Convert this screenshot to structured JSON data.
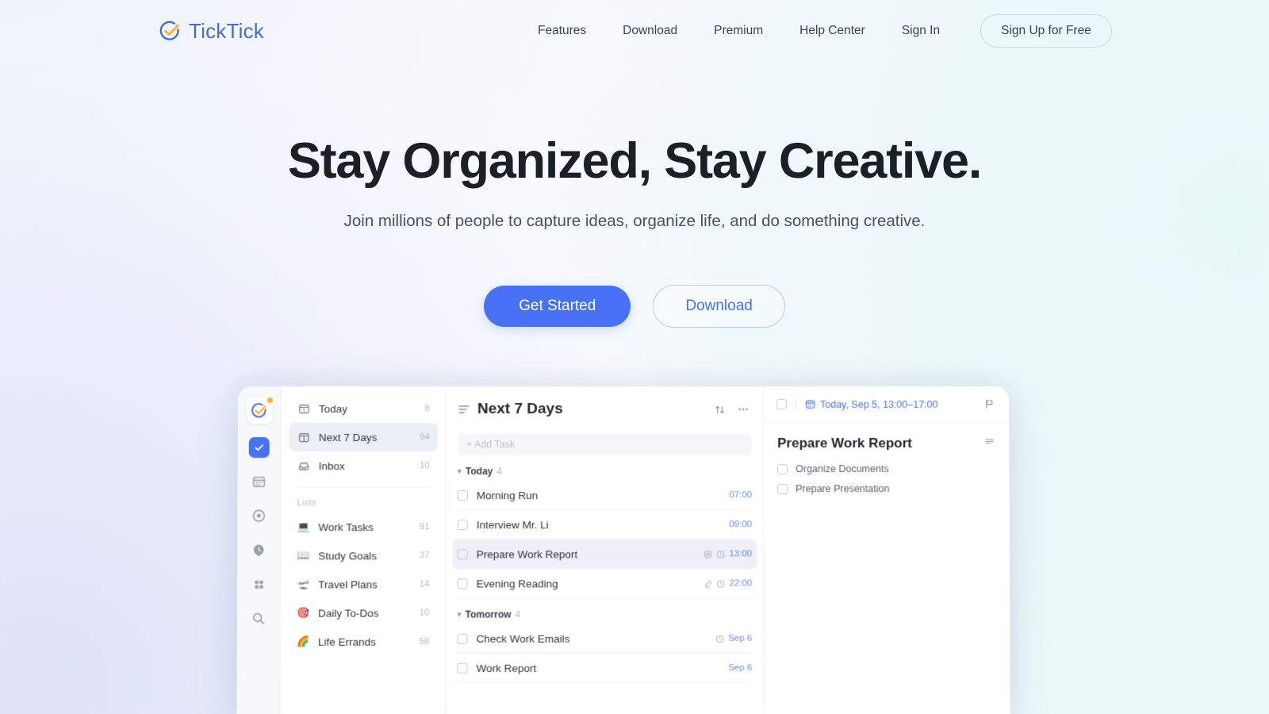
{
  "brand": {
    "name": "TickTick",
    "logo_icon": "ticktick-check-circle-icon",
    "logo_color": "#4a6bd6",
    "accent_color": "#ffb224"
  },
  "nav": {
    "links": [
      {
        "label": "Features"
      },
      {
        "label": "Download"
      },
      {
        "label": "Premium"
      },
      {
        "label": "Help Center"
      },
      {
        "label": "Sign In"
      }
    ],
    "signup_label": "Sign Up for Free"
  },
  "hero": {
    "title": "Stay Organized, Stay Creative.",
    "subtitle": "Join millions of people to capture ideas, organize life, and do something creative.",
    "primary_cta": "Get Started",
    "secondary_cta": "Download",
    "primary_color": "#4772f5"
  },
  "app": {
    "rail": [
      {
        "name": "logo-badge",
        "icon": "ticktick-logo-icon",
        "active": false
      },
      {
        "name": "tasks",
        "icon": "check-square-icon",
        "active": true
      },
      {
        "name": "calendar",
        "icon": "calendar-icon",
        "active": false
      },
      {
        "name": "focus",
        "icon": "target-icon",
        "active": false
      },
      {
        "name": "pomo",
        "icon": "clock-pin-icon",
        "active": false
      },
      {
        "name": "more",
        "icon": "grid-dots-icon",
        "active": false
      },
      {
        "name": "search",
        "icon": "search-icon",
        "active": false
      }
    ],
    "sidebar": {
      "smart_lists": [
        {
          "label": "Today",
          "count": "8",
          "icon": "calendar-today-icon",
          "selected": false
        },
        {
          "label": "Next 7 Days",
          "count": "94",
          "icon": "calendar-week-icon",
          "selected": true
        },
        {
          "label": "Inbox",
          "count": "10",
          "icon": "inbox-icon",
          "selected": false
        }
      ],
      "group_title": "Lists",
      "lists": [
        {
          "label": "Work Tasks",
          "count": "91",
          "emoji": "💻"
        },
        {
          "label": "Study Goals",
          "count": "37",
          "emoji": "📖"
        },
        {
          "label": "Travel Plans",
          "count": "14",
          "emoji": "🛫"
        },
        {
          "label": "Daily To-Dos",
          "count": "10",
          "emoji": "🎯"
        },
        {
          "label": "Life Errands",
          "count": "58",
          "emoji": "🌈"
        }
      ]
    },
    "task_panel": {
      "title": "Next 7 Days",
      "add_task_placeholder": "+ Add Task",
      "sort_icon": "sort-arrows-icon",
      "more_icon": "more-horizontal-icon",
      "view_icon": "list-view-icon",
      "groups": [
        {
          "label": "Today",
          "count": "4",
          "tasks": [
            {
              "name": "Morning Run",
              "when": "07:00",
              "icons": [],
              "selected": false
            },
            {
              "name": "Interview Mr. Li",
              "when": "09:00",
              "icons": [],
              "selected": false
            },
            {
              "name": "Prepare Work Report",
              "when": "13:00",
              "icons": [
                "note-icon",
                "alarm-clock-icon"
              ],
              "selected": true
            },
            {
              "name": "Evening Reading",
              "when": "22:00",
              "icons": [
                "paperclip-icon",
                "alarm-clock-icon"
              ],
              "selected": false
            }
          ]
        },
        {
          "label": "Tomorrow",
          "count": "4",
          "tasks": [
            {
              "name": "Check Work Emails",
              "when": "Sep 6",
              "icons": [
                "alarm-clock-icon"
              ],
              "selected": false
            },
            {
              "name": "Work Report",
              "when": "Sep 6",
              "icons": [],
              "selected": false
            }
          ]
        }
      ]
    },
    "detail_panel": {
      "date": "Today, Sep 5, 13:00–17:00",
      "date_icon": "calendar-icon",
      "flag_icon": "flag-icon",
      "menu_icon": "menu-lines-icon",
      "title": "Prepare Work Report",
      "subtasks": [
        {
          "label": "Organize Documents"
        },
        {
          "label": "Prepare Presentation"
        }
      ]
    }
  }
}
